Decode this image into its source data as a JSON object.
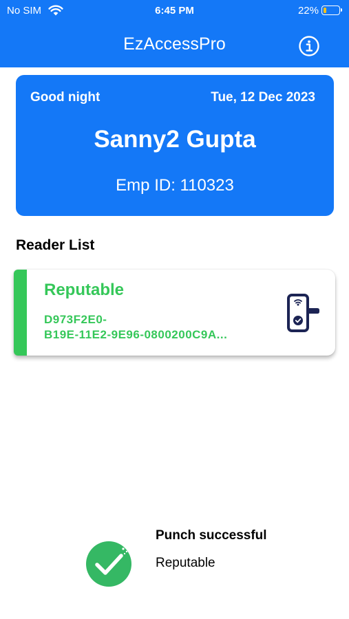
{
  "status_bar": {
    "carrier": "No SIM",
    "time": "6:45 PM",
    "battery_percent": "22%",
    "battery_level": 0.22,
    "battery_color": "#f7c21b"
  },
  "header": {
    "title": "EzAccessPro",
    "info_icon": "info-circle-icon",
    "background": "#1478f7"
  },
  "greeting_card": {
    "greeting": "Good night",
    "date": "Tue, 12 Dec 2023",
    "name": "Sanny2 Gupta",
    "emp_id": "Emp ID: 110323"
  },
  "reader_list": {
    "title": "Reader List",
    "items": [
      {
        "name": "Reputable",
        "id": "D973F2E0-\nB19E-11E2-9E96-0800200C9A...",
        "icon": "smart-lock-icon",
        "accent_color": "#35c759"
      }
    ]
  },
  "toast": {
    "title": "Punch successful",
    "subtitle": "Reputable",
    "icon": "check-circle-icon"
  }
}
